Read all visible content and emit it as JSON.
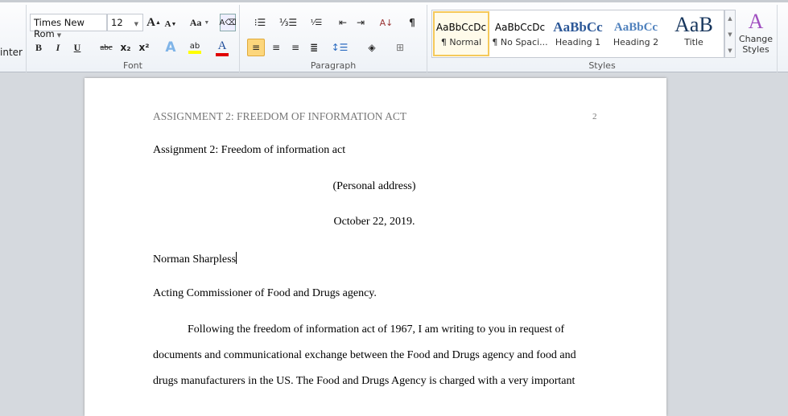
{
  "ribbon": {
    "clipboard_fragment": "inter",
    "font": {
      "label": "Font",
      "font_name": "Times New Rom",
      "font_size": "12",
      "change_case": "Aa",
      "bold": "B",
      "italic": "I",
      "underline": "U",
      "strikethrough": "abc",
      "subscript": "x₂",
      "superscript": "x²",
      "highlight": "ab",
      "font_color": "A",
      "highlight_color": "#ffff00",
      "font_color_value": "#e00000"
    },
    "paragraph": {
      "label": "Paragraph",
      "pilcrow": "¶"
    },
    "styles": {
      "label": "Styles",
      "items": [
        {
          "preview": "AaBbCcDc",
          "name": "¶ Normal",
          "selected": true
        },
        {
          "preview": "AaBbCcDc",
          "name": "¶ No Spaci..."
        },
        {
          "preview": "AaBbCc",
          "name": "Heading 1"
        },
        {
          "preview": "AaBbCc",
          "name": "Heading 2"
        },
        {
          "preview": "AaB",
          "name": "Title"
        }
      ],
      "change_styles": "Change Styles"
    }
  },
  "document": {
    "header_text": "ASSIGNMENT 2: FREEDOM OF INFORMATION ACT",
    "page_number": "2",
    "lines": [
      "Assignment 2: Freedom of information act",
      "(Personal address)",
      "October 22, 2019.",
      "Norman Sharpless",
      "Acting Commissioner of Food and Drugs agency.",
      "Following the freedom of information act of 1967, I am writing to you in request of",
      "documents and communicational exchange between the Food and Drugs agency and food and",
      "drugs manufacturers in the US. The Food and Drugs Agency is charged with a very important"
    ]
  }
}
